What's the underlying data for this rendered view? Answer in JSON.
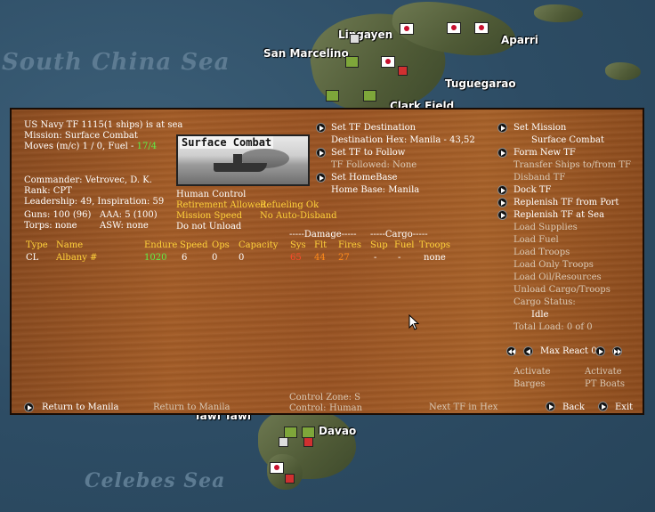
{
  "map": {
    "sea_labels": [
      "South China Sea",
      "Celebes Sea"
    ],
    "cities": [
      "Lingayen",
      "Aparri",
      "San Marcelino",
      "Tuguegarao",
      "Clark Field",
      "Davao",
      "Tawi Tawi"
    ]
  },
  "panel": {
    "tf_header": "US Navy TF 1115(1 ships) is at sea",
    "mission_line": "Mission:  Surface Combat",
    "moves_prefix": "Moves (m/c)  1 / 0, Fuel - ",
    "fuel_value": "17/4",
    "mission_image_caption": "Surface Combat",
    "commander": "Commander: Vetrovec, D. K.",
    "rank": "Rank: CPT",
    "leadership": "Leadership: 49, Inspiration: 59",
    "guns": "Guns: 100 (96)",
    "aaa": "AAA: 5 (100)",
    "torps": "Torps: none",
    "asw": "ASW: none",
    "human_control": "Human Control",
    "retirement": "Retirement Allowed",
    "refueling": "Refueling Ok",
    "mission_speed": "Mission Speed",
    "no_auto_disband": "No Auto-Disband",
    "do_not_unload": "Do not Unload",
    "mid_actions": {
      "set_destination": "Set TF Destination",
      "destination_hex": "Destination Hex: Manila - 43,52",
      "set_follow": "Set TF to Follow",
      "tf_followed": "TF Followed: None",
      "set_homebase": "Set HomeBase",
      "home_base": "Home Base: Manila"
    },
    "right_actions": {
      "set_mission": "Set Mission",
      "current_mission": "Surface Combat",
      "form_new_tf": "Form New TF",
      "transfer_ships": "Transfer Ships to/from TF",
      "disband_tf": "Disband TF",
      "dock_tf": "Dock TF",
      "replenish_port": "Replenish TF from Port",
      "replenish_sea": "Replenish TF at Sea",
      "load_supplies": "Load Supplies",
      "load_fuel": "Load Fuel",
      "load_troops": "Load Troops",
      "load_only_troops": "Load Only Troops",
      "load_oil": "Load Oil/Resources",
      "unload_cargo": "Unload Cargo/Troops",
      "cargo_status": "Cargo Status:",
      "cargo_state": "Idle",
      "total_load": "Total Load: 0 of 0",
      "max_react": "Max React 0",
      "activate1": "Activate",
      "barges": "Barges",
      "activate2": "Activate",
      "pt_boats": "PT Boats"
    },
    "table": {
      "group_damage": "-----Damage-----",
      "group_cargo": "-----Cargo-----",
      "headers": [
        "Type",
        "Name",
        "Endure",
        "Speed",
        "Ops",
        "Capacity",
        "Sys",
        "Flt",
        "Fires",
        "Sup",
        "Fuel",
        "Troops"
      ],
      "rows": [
        {
          "type": "CL",
          "name": "Albany #",
          "endure": "1020",
          "speed": "6",
          "ops": "0",
          "capacity": "0",
          "sys": "65",
          "flt": "44",
          "fires": "27",
          "sup": "-",
          "fuel": "-",
          "troops": "none"
        }
      ]
    },
    "footer": {
      "return_btn": "Return to Manila",
      "return_text": "Return to Manila",
      "control_zone": "Control Zone: S",
      "control_label": "Control:",
      "control_value": "Human",
      "next_tf": "Next TF in Hex",
      "back": "Back",
      "exit": "Exit"
    }
  }
}
